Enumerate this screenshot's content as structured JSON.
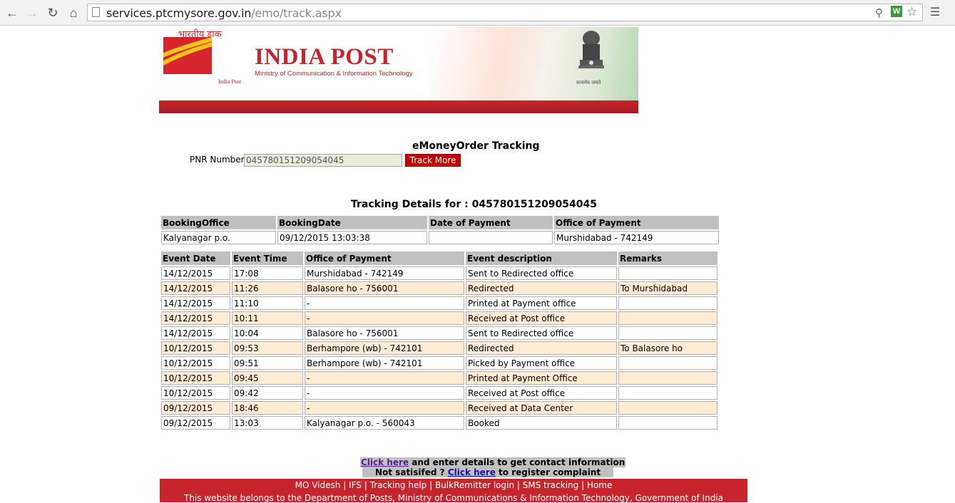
{
  "browser": {
    "url_host": "services.ptcmysore.gov.in",
    "url_path": "/emo/track.aspx"
  },
  "banner": {
    "hindi_text": "भारतीय डाक",
    "brand": "INDIA POST",
    "ministry": "Ministry of Communication & Information Technology",
    "logo_caption": "India Post",
    "emblem_caption": "सत्यमेव जयते"
  },
  "form": {
    "title": "eMoneyOrder Tracking",
    "pnr_label": "PNR Number :",
    "pnr_value": "045780151209054045",
    "button_label": "Track More"
  },
  "details_title": "Tracking Details for : 045780151209054045",
  "booking": {
    "headers": [
      "BookingOffice",
      "BookingDate",
      "Date of Payment",
      "Office of Payment"
    ],
    "row": [
      "Kalyanagar p.o.",
      "09/12/2015 13:03:38",
      "",
      "Murshidabad - 742149"
    ]
  },
  "events": {
    "headers": [
      "Event Date",
      "Event Time",
      "Office of Payment",
      "Event description",
      "Remarks"
    ],
    "rows": [
      [
        "14/12/2015",
        "17:08",
        "Murshidabad - 742149",
        "Sent to Redirected office",
        ""
      ],
      [
        "14/12/2015",
        "11:26",
        "Balasore ho - 756001",
        "Redirected",
        "To Murshidabad"
      ],
      [
        "14/12/2015",
        "11:10",
        "-",
        "Printed at Payment office",
        ""
      ],
      [
        "14/12/2015",
        "10:11",
        "-",
        "Received at Post office",
        ""
      ],
      [
        "14/12/2015",
        "10:04",
        "Balasore ho - 756001",
        "Sent to Redirected office",
        ""
      ],
      [
        "10/12/2015",
        "09:53",
        "Berhampore (wb) - 742101",
        "Redirected",
        "To Balasore ho"
      ],
      [
        "10/12/2015",
        "09:51",
        "Berhampore (wb) - 742101",
        "Picked by Payment office",
        ""
      ],
      [
        "10/12/2015",
        "09:45",
        "-",
        "Printed at Payment Office",
        ""
      ],
      [
        "10/12/2015",
        "09:42",
        "-",
        "Received at Post office",
        ""
      ],
      [
        "09/12/2015",
        "18:46",
        "-",
        "Received at Data Center",
        ""
      ],
      [
        "09/12/2015",
        "13:03",
        "Kalyanagar p.o. - 560043",
        "Booked",
        ""
      ]
    ]
  },
  "contact": {
    "link1": "Click here",
    "text1": " and enter details to get contact information",
    "text2_pre": "Not satisifed ? ",
    "link2": "Click here",
    "text2_post": " to register complaint"
  },
  "footer": {
    "links": [
      "MO Videsh",
      "IFS",
      "Tracking help",
      "BulkRemitter login",
      "SMS tracking",
      "Home"
    ],
    "separator": " | ",
    "owner": "This website belongs to the Department of Posts, Ministry of Communications & Information Technology, Government of India"
  },
  "colors": {
    "india_post_red": "#c8242c",
    "button_red": "#c80000",
    "header_grey": "#c0c0c0",
    "alt_row": "#fdebd6"
  }
}
